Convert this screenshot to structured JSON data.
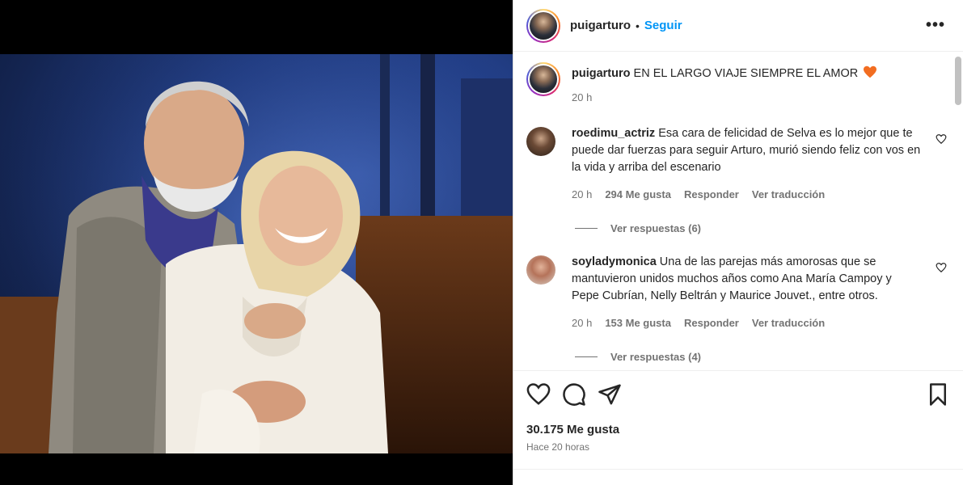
{
  "post": {
    "username": "puigarturo",
    "follow_label": "Seguir",
    "dot": "•",
    "more_label": "•••",
    "caption": "EN EL LARGO VIAJE SIEMPRE EL AMOR",
    "caption_time": "20 h",
    "likes": "30.175 Me gusta",
    "posted_ago": "Hace 20 horas"
  },
  "comments": [
    {
      "username": "roedimu_actriz",
      "text": "Esa cara de felicidad de Selva es lo mejor que te puede dar fuerzas para seguir Arturo, murió siendo feliz con vos en la vida y arriba del escenario",
      "time": "20 h",
      "likes": "294 Me gusta",
      "reply_label": "Responder",
      "translate_label": "Ver traducción",
      "view_replies": "Ver respuestas (6)"
    },
    {
      "username": "soyladymonica",
      "text": "Una de las parejas más amorosas que se mantuvieron unidos muchos años como Ana María Campoy y Pepe Cubrían, Nelly Beltrán y Maurice Jouvet., entre otros.",
      "time": "20 h",
      "likes": "153 Me gusta",
      "reply_label": "Responder",
      "translate_label": "Ver traducción",
      "view_replies": "Ver respuestas (4)"
    }
  ],
  "colors": {
    "accent": "#0095f6",
    "heart": "#f26d21",
    "muted": "#737373"
  },
  "icons": [
    "more-icon",
    "heart-icon",
    "comment-icon",
    "share-icon",
    "bookmark-icon",
    "orange-heart-emoji"
  ]
}
